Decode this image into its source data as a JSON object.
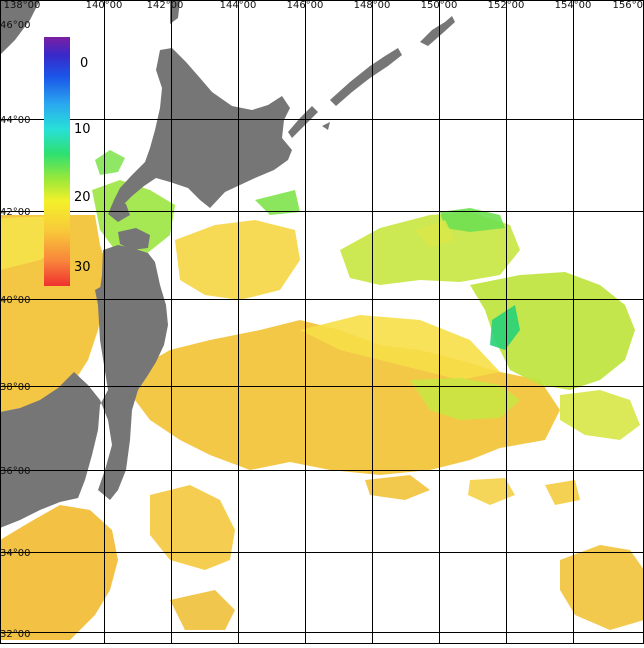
{
  "map": {
    "colors": {
      "land": "#767676",
      "ocean_nodata": "#ffffff",
      "grid": "#000000",
      "label": "#111111",
      "sst_warm": "#f2c33a",
      "sst_mid": "#f6e24a",
      "sst_cool": "#cbe640",
      "sst_green": "#7be34a",
      "sst_cold": "#25d47a"
    },
    "longitude_labels": [
      "138°00",
      "140°00",
      "142°00",
      "144°00",
      "146°00",
      "148°00",
      "150°00",
      "152°00",
      "154°00",
      "156°0"
    ],
    "latitude_labels": [
      "46°00",
      "44°00",
      "42°00",
      "40°00",
      "38°00",
      "36°00",
      "34°00",
      "32°00"
    ]
  },
  "colorbar": {
    "tick_labels": [
      "0",
      "10",
      "20",
      "30"
    ],
    "gradient": [
      "#7a1fa2",
      "#3a28c8",
      "#1a56e8",
      "#2aa8f0",
      "#28e0d8",
      "#2ee070",
      "#9ae83a",
      "#f4f02a",
      "#f8c83a",
      "#f8843a",
      "#f03030"
    ]
  }
}
